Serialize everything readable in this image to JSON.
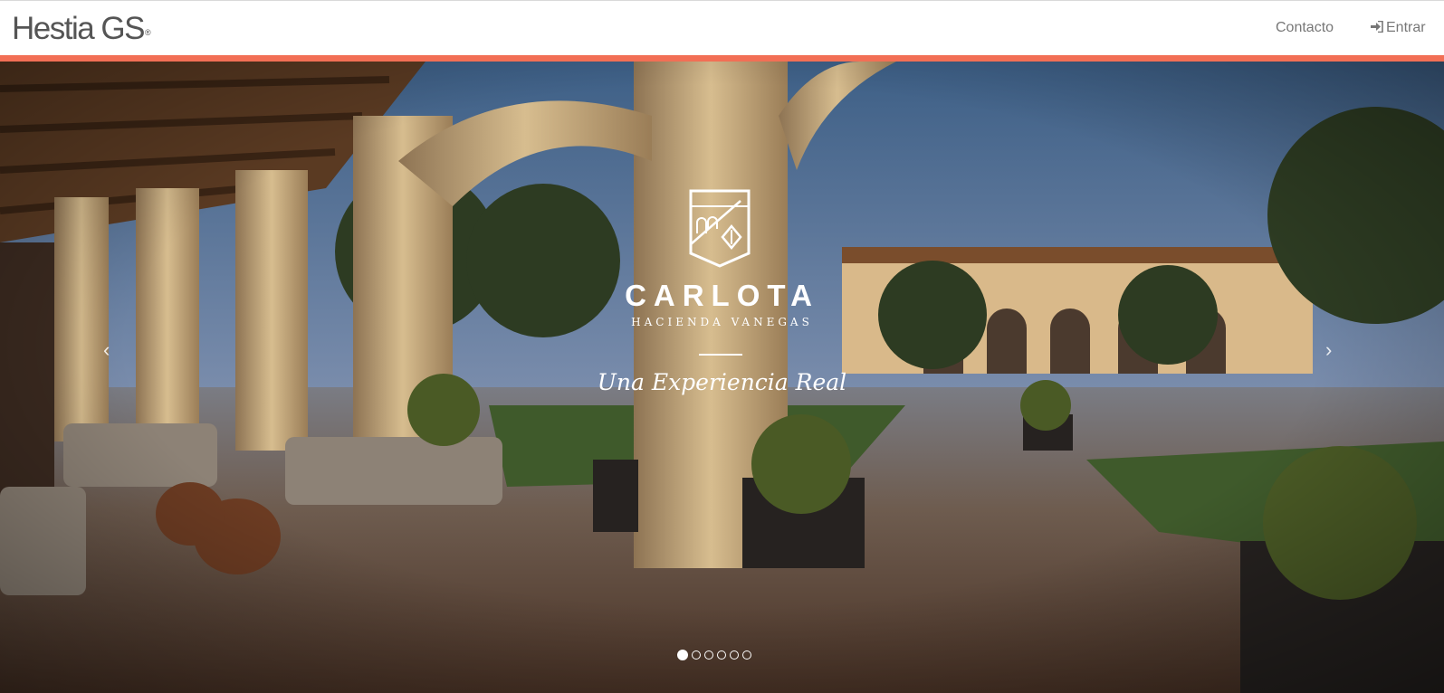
{
  "header": {
    "logo_text": "Hestia GS",
    "logo_mark": "®",
    "nav": {
      "contact_label": "Contacto",
      "login_label": "Entrar",
      "login_icon": "sign-in-icon"
    }
  },
  "colors": {
    "accent": "#f26f55",
    "text_muted": "#777777",
    "logo": "#555555"
  },
  "hero": {
    "brand_name": "CARLOTA",
    "brand_subtitle": "HACIENDA VANEGAS",
    "tagline": "Una Experiencia Real",
    "prev_label": "‹",
    "next_label": "›",
    "slide_count": 6,
    "active_slide": 1
  }
}
